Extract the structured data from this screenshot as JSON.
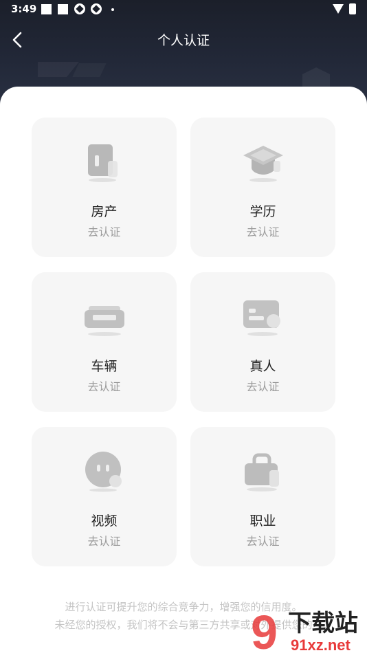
{
  "status_bar": {
    "time": "3:49"
  },
  "nav": {
    "title": "个人认证"
  },
  "cards": [
    {
      "name": "房产",
      "action": "去认证",
      "icon": "house-deed-icon"
    },
    {
      "name": "学历",
      "action": "去认证",
      "icon": "graduation-cap-icon"
    },
    {
      "name": "车辆",
      "action": "去认证",
      "icon": "car-icon"
    },
    {
      "name": "真人",
      "action": "去认证",
      "icon": "id-card-icon"
    },
    {
      "name": "视频",
      "action": "去认证",
      "icon": "face-icon"
    },
    {
      "name": "职业",
      "action": "去认证",
      "icon": "briefcase-icon"
    }
  ],
  "footer": {
    "line1": "进行认证可提升您的综合竞争力，增强您的信用度。",
    "line2": "未经您的授权，我们将不会与第三方共享或对外提供您的"
  },
  "watermark": {
    "text": "下载站",
    "url_text": "91xz.net"
  },
  "colors": {
    "header_bg": "#1b1f2a",
    "card_bg": "#f6f6f6",
    "accent_watermark": "#e83a3a"
  }
}
